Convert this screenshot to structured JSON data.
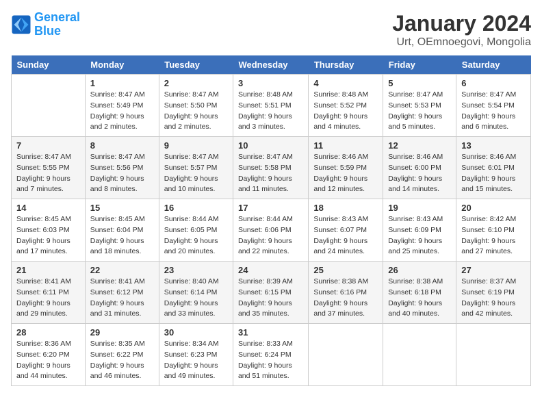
{
  "logo": {
    "line1": "General",
    "line2": "Blue"
  },
  "title": "January 2024",
  "subtitle": "Urt, OEmnoegovi, Mongolia",
  "days_header": [
    "Sunday",
    "Monday",
    "Tuesday",
    "Wednesday",
    "Thursday",
    "Friday",
    "Saturday"
  ],
  "weeks": [
    [
      {
        "day": "",
        "info": ""
      },
      {
        "day": "1",
        "info": "Sunrise: 8:47 AM\nSunset: 5:49 PM\nDaylight: 9 hours\nand 2 minutes."
      },
      {
        "day": "2",
        "info": "Sunrise: 8:47 AM\nSunset: 5:50 PM\nDaylight: 9 hours\nand 2 minutes."
      },
      {
        "day": "3",
        "info": "Sunrise: 8:48 AM\nSunset: 5:51 PM\nDaylight: 9 hours\nand 3 minutes."
      },
      {
        "day": "4",
        "info": "Sunrise: 8:48 AM\nSunset: 5:52 PM\nDaylight: 9 hours\nand 4 minutes."
      },
      {
        "day": "5",
        "info": "Sunrise: 8:47 AM\nSunset: 5:53 PM\nDaylight: 9 hours\nand 5 minutes."
      },
      {
        "day": "6",
        "info": "Sunrise: 8:47 AM\nSunset: 5:54 PM\nDaylight: 9 hours\nand 6 minutes."
      }
    ],
    [
      {
        "day": "7",
        "info": "Sunrise: 8:47 AM\nSunset: 5:55 PM\nDaylight: 9 hours\nand 7 minutes."
      },
      {
        "day": "8",
        "info": "Sunrise: 8:47 AM\nSunset: 5:56 PM\nDaylight: 9 hours\nand 8 minutes."
      },
      {
        "day": "9",
        "info": "Sunrise: 8:47 AM\nSunset: 5:57 PM\nDaylight: 9 hours\nand 10 minutes."
      },
      {
        "day": "10",
        "info": "Sunrise: 8:47 AM\nSunset: 5:58 PM\nDaylight: 9 hours\nand 11 minutes."
      },
      {
        "day": "11",
        "info": "Sunrise: 8:46 AM\nSunset: 5:59 PM\nDaylight: 9 hours\nand 12 minutes."
      },
      {
        "day": "12",
        "info": "Sunrise: 8:46 AM\nSunset: 6:00 PM\nDaylight: 9 hours\nand 14 minutes."
      },
      {
        "day": "13",
        "info": "Sunrise: 8:46 AM\nSunset: 6:01 PM\nDaylight: 9 hours\nand 15 minutes."
      }
    ],
    [
      {
        "day": "14",
        "info": "Sunrise: 8:45 AM\nSunset: 6:03 PM\nDaylight: 9 hours\nand 17 minutes."
      },
      {
        "day": "15",
        "info": "Sunrise: 8:45 AM\nSunset: 6:04 PM\nDaylight: 9 hours\nand 18 minutes."
      },
      {
        "day": "16",
        "info": "Sunrise: 8:44 AM\nSunset: 6:05 PM\nDaylight: 9 hours\nand 20 minutes."
      },
      {
        "day": "17",
        "info": "Sunrise: 8:44 AM\nSunset: 6:06 PM\nDaylight: 9 hours\nand 22 minutes."
      },
      {
        "day": "18",
        "info": "Sunrise: 8:43 AM\nSunset: 6:07 PM\nDaylight: 9 hours\nand 24 minutes."
      },
      {
        "day": "19",
        "info": "Sunrise: 8:43 AM\nSunset: 6:09 PM\nDaylight: 9 hours\nand 25 minutes."
      },
      {
        "day": "20",
        "info": "Sunrise: 8:42 AM\nSunset: 6:10 PM\nDaylight: 9 hours\nand 27 minutes."
      }
    ],
    [
      {
        "day": "21",
        "info": "Sunrise: 8:41 AM\nSunset: 6:11 PM\nDaylight: 9 hours\nand 29 minutes."
      },
      {
        "day": "22",
        "info": "Sunrise: 8:41 AM\nSunset: 6:12 PM\nDaylight: 9 hours\nand 31 minutes."
      },
      {
        "day": "23",
        "info": "Sunrise: 8:40 AM\nSunset: 6:14 PM\nDaylight: 9 hours\nand 33 minutes."
      },
      {
        "day": "24",
        "info": "Sunrise: 8:39 AM\nSunset: 6:15 PM\nDaylight: 9 hours\nand 35 minutes."
      },
      {
        "day": "25",
        "info": "Sunrise: 8:38 AM\nSunset: 6:16 PM\nDaylight: 9 hours\nand 37 minutes."
      },
      {
        "day": "26",
        "info": "Sunrise: 8:38 AM\nSunset: 6:18 PM\nDaylight: 9 hours\nand 40 minutes."
      },
      {
        "day": "27",
        "info": "Sunrise: 8:37 AM\nSunset: 6:19 PM\nDaylight: 9 hours\nand 42 minutes."
      }
    ],
    [
      {
        "day": "28",
        "info": "Sunrise: 8:36 AM\nSunset: 6:20 PM\nDaylight: 9 hours\nand 44 minutes."
      },
      {
        "day": "29",
        "info": "Sunrise: 8:35 AM\nSunset: 6:22 PM\nDaylight: 9 hours\nand 46 minutes."
      },
      {
        "day": "30",
        "info": "Sunrise: 8:34 AM\nSunset: 6:23 PM\nDaylight: 9 hours\nand 49 minutes."
      },
      {
        "day": "31",
        "info": "Sunrise: 8:33 AM\nSunset: 6:24 PM\nDaylight: 9 hours\nand 51 minutes."
      },
      {
        "day": "",
        "info": ""
      },
      {
        "day": "",
        "info": ""
      },
      {
        "day": "",
        "info": ""
      }
    ]
  ]
}
